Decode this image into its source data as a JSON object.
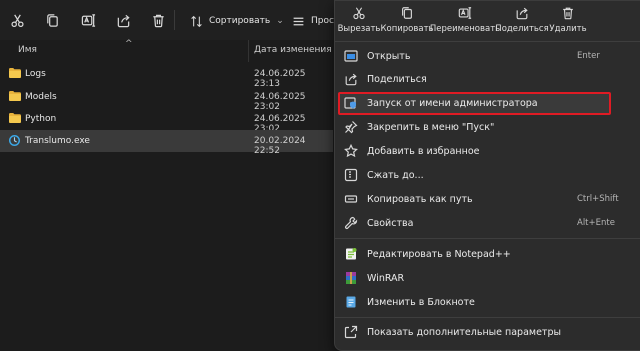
{
  "toolbar": {
    "sort_label": "Сортировать",
    "view_label": "Просм",
    "icons": [
      "cut-icon",
      "copy-icon",
      "rename-icon",
      "share-icon",
      "delete-icon"
    ]
  },
  "columns": {
    "name": "Имя",
    "date": "Дата изменения"
  },
  "files": [
    {
      "name": "Logs",
      "date": "24.06.2025 23:13",
      "type": "folder"
    },
    {
      "name": "Models",
      "date": "24.06.2025 23:02",
      "type": "folder"
    },
    {
      "name": "Python",
      "date": "24.06.2025 23:02",
      "type": "folder"
    },
    {
      "name": "Translumo.exe",
      "date": "20.02.2024 22:52",
      "type": "exe",
      "selected": true
    }
  ],
  "context_menu": {
    "quick_actions": [
      {
        "label": "Вырезать",
        "icon": "cut-icon"
      },
      {
        "label": "Копировать",
        "icon": "copy-icon"
      },
      {
        "label": "Переименовать",
        "icon": "rename-icon"
      },
      {
        "label": "Поделиться",
        "icon": "share-icon"
      },
      {
        "label": "Удалить",
        "icon": "delete-icon"
      }
    ],
    "items": [
      {
        "label": "Открыть",
        "shortcut": "Enter",
        "icon": "open-app-icon"
      },
      {
        "label": "Поделиться",
        "shortcut": "",
        "icon": "share-icon"
      },
      {
        "label": "Запуск от имени администратора",
        "shortcut": "",
        "icon": "admin-shield-icon",
        "highlighted": true
      },
      {
        "label": "Закрепить в меню \"Пуск\"",
        "shortcut": "",
        "icon": "pin-icon"
      },
      {
        "label": "Добавить в избранное",
        "shortcut": "",
        "icon": "star-icon"
      },
      {
        "label": "Сжать до...",
        "shortcut": "",
        "icon": "zip-icon"
      },
      {
        "label": "Копировать как путь",
        "shortcut": "Ctrl+Shift",
        "icon": "copy-path-icon"
      },
      {
        "label": "Свойства",
        "shortcut": "Alt+Ente",
        "icon": "properties-wrench-icon"
      },
      {
        "label": "Редактировать в Notepad++",
        "shortcut": "",
        "icon": "notepadpp-icon"
      },
      {
        "label": "WinRAR",
        "shortcut": "",
        "icon": "winrar-icon"
      },
      {
        "label": "Изменить в Блокноте",
        "shortcut": "",
        "icon": "notepad-icon"
      },
      {
        "label": "Показать дополнительные параметры",
        "shortcut": "",
        "icon": "more-options-icon"
      }
    ]
  },
  "colors": {
    "accent": "#0a84ff",
    "folder": "#e8b33c",
    "highlight_border": "#e01b24"
  }
}
